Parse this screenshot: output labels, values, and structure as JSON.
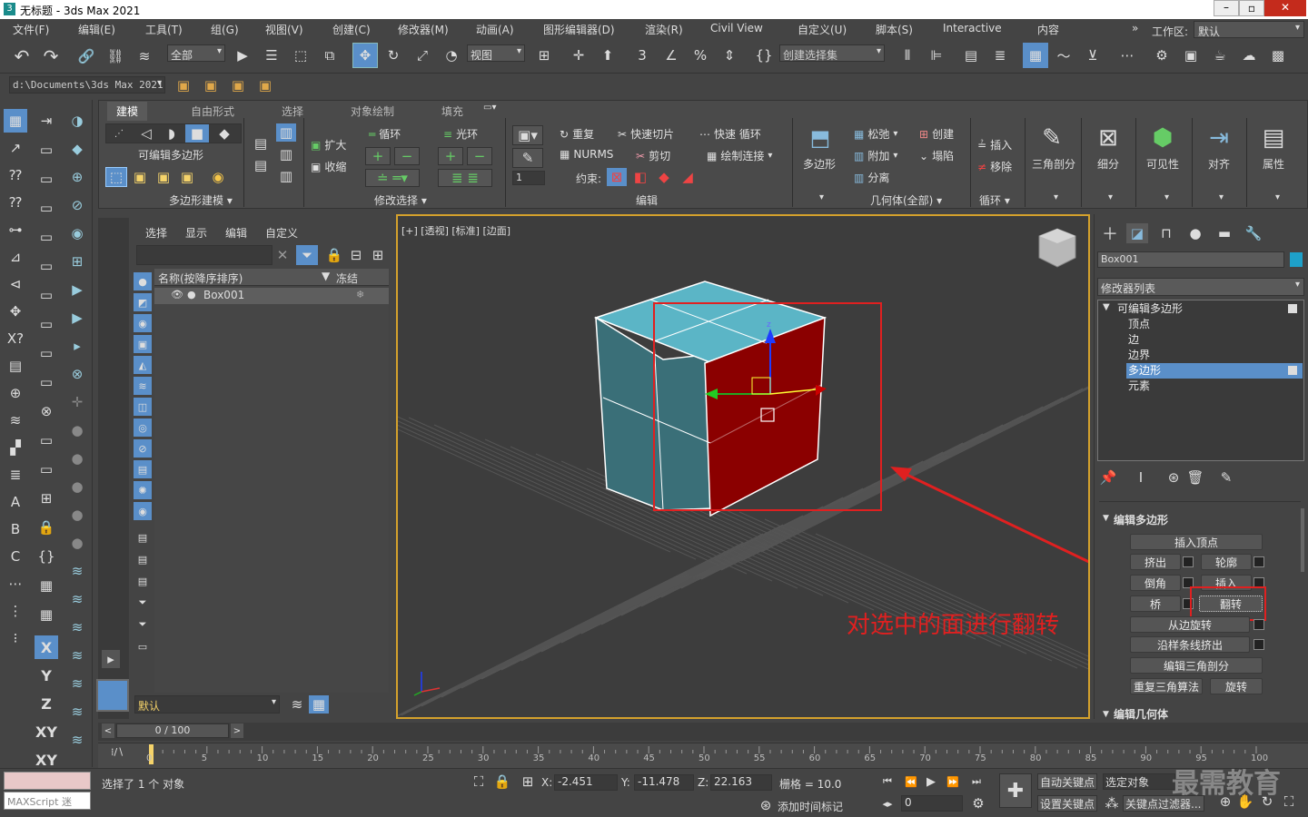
{
  "window": {
    "title": "无标题 - 3ds Max 2021"
  },
  "menu": [
    "文件(F)",
    "编辑(E)",
    "工具(T)",
    "组(G)",
    "视图(V)",
    "创建(C)",
    "修改器(M)",
    "动画(A)",
    "图形编辑器(D)",
    "渲染(R)",
    "Civil View",
    "自定义(U)",
    "脚本(S)",
    "Interactive",
    "内容"
  ],
  "workspace": {
    "label": "工作区:",
    "value": "默认"
  },
  "toolbar": {
    "selection_filter": "全部",
    "ref_coord": "视图",
    "named_selection": "创建选择集",
    "path": "d:\\Documents\\3ds Max 2021"
  },
  "ribbon": {
    "tabs": [
      "建模",
      "自由形式",
      "选择",
      "对象绘制",
      "填充"
    ],
    "poly_model_label": "可编辑多边形",
    "expand": "扩大",
    "shrink": "收缩",
    "loop": "循环",
    "ring": "光环",
    "repeat": "重复",
    "nurms": "NURMS",
    "quickslice": "快速切片",
    "cut": "剪切",
    "quickloop": "快速 循环",
    "swiftloop": "绘制连接",
    "constraint": "约束:",
    "spinner": "1",
    "polygon": "多边形",
    "relax": "松弛",
    "create": "创建",
    "attach": "附加",
    "collapse": "塌陷",
    "detach": "分离",
    "insert": "插入",
    "remove": "移除",
    "tri": "三角剖分",
    "subdivide": "细分",
    "visibility": "可见性",
    "align": "对齐",
    "props": "属性",
    "panel_labels": [
      "多边形建模 ▾",
      "修改选择 ▾",
      "编辑",
      "几何体(全部) ▾",
      "循环 ▾"
    ]
  },
  "scene_explorer": {
    "menu": [
      "选择",
      "显示",
      "编辑",
      "自定义"
    ],
    "col_name": "名称(按降序排序)",
    "col_freeze": "冻结",
    "rows": [
      {
        "name": "Box001"
      }
    ],
    "layer": "默认"
  },
  "viewport": {
    "label": "[+] [透视] [标准] [边面]",
    "annotation": "对选中的面进行翻转"
  },
  "command_panel": {
    "object_name": "Box001",
    "modifier_list": "修改器列表",
    "stack": [
      "可编辑多边形",
      "顶点",
      "边",
      "边界",
      "多边形",
      "元素"
    ],
    "edit_poly_title": "编辑多边形",
    "buttons": {
      "insert_vertex": "插入顶点",
      "extrude": "挤出",
      "outline": "轮廓",
      "bevel": "倒角",
      "inset": "插入",
      "bridge": "桥",
      "flip": "翻转",
      "hinge": "从边旋转",
      "extrude_spline": "沿样条线挤出",
      "edit_tri": "编辑三角剖分",
      "retri": "重复三角算法",
      "turn": "旋转"
    },
    "edit_geom_title": "编辑几何体"
  },
  "timeline": {
    "frame": "0 / 100",
    "ticks": [
      "0",
      "5",
      "10",
      "15",
      "20",
      "25",
      "30",
      "35",
      "40",
      "45",
      "50",
      "55",
      "60",
      "65",
      "70",
      "75",
      "80",
      "85",
      "90",
      "95",
      "100"
    ]
  },
  "status": {
    "maxscript": "MAXScript 迷",
    "selected": "选择了 1 个 对象",
    "x": "-2.451",
    "y": "-11.478",
    "z": "22.163",
    "grid": "栅格 = 10.0",
    "add_time_tag": "添加时间标记",
    "auto_key": "自动关键点",
    "selected_obj": "选定对象",
    "set_key": "设置关键点",
    "key_filter": "关键点过滤器...",
    "frame_field": "0",
    "watermark": "最需教育"
  }
}
